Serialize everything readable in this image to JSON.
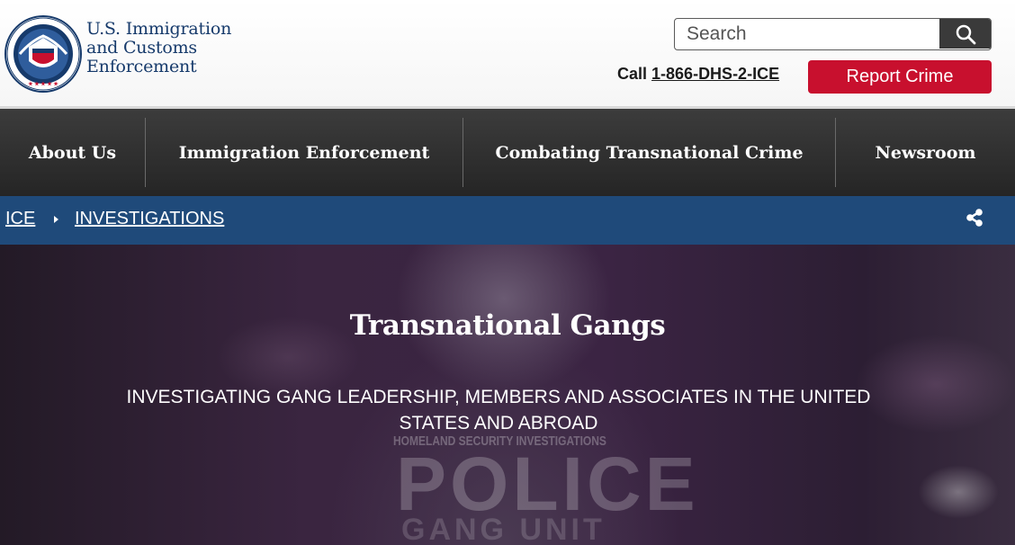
{
  "header": {
    "agency_lines": [
      "U.S. Immigration",
      "and Customs",
      "Enforcement"
    ],
    "search_placeholder": "Search",
    "call_prefix": "Call",
    "call_number": "1-866-DHS-2-ICE",
    "report_label": "Report Crime",
    "seal_text": {
      "top": "DEPARTMENT OF",
      "bottom": "HOMELAND SECURITY",
      "band": "DHS AT 20"
    }
  },
  "nav": {
    "items": [
      {
        "label": "About Us"
      },
      {
        "label": "Immigration Enforcement"
      },
      {
        "label": "Combating Transnational Crime"
      },
      {
        "label": "Newsroom"
      }
    ]
  },
  "breadcrumb": {
    "items": [
      {
        "label": "ICE"
      },
      {
        "label": "INVESTIGATIONS"
      }
    ]
  },
  "hero": {
    "title": "Transnational Gangs",
    "subtitle": "INVESTIGATING GANG LEADERSHIP, MEMBERS AND ASSOCIATES IN THE UNITED STATES AND ABROAD",
    "photo_text": [
      "HOMELAND SECURITY INVESTIGATIONS",
      "POLICE",
      "GANG UNIT"
    ]
  },
  "colors": {
    "brand_navy": "#163a6b",
    "report_red": "#c8102e",
    "nav_dark": "#2b2b2b",
    "breadcrumb_blue": "#1f4a7a",
    "hero_purple": "#3b2443"
  },
  "icons": [
    "dhs-seal",
    "search-icon",
    "chevron-right-icon",
    "share-icon"
  ]
}
